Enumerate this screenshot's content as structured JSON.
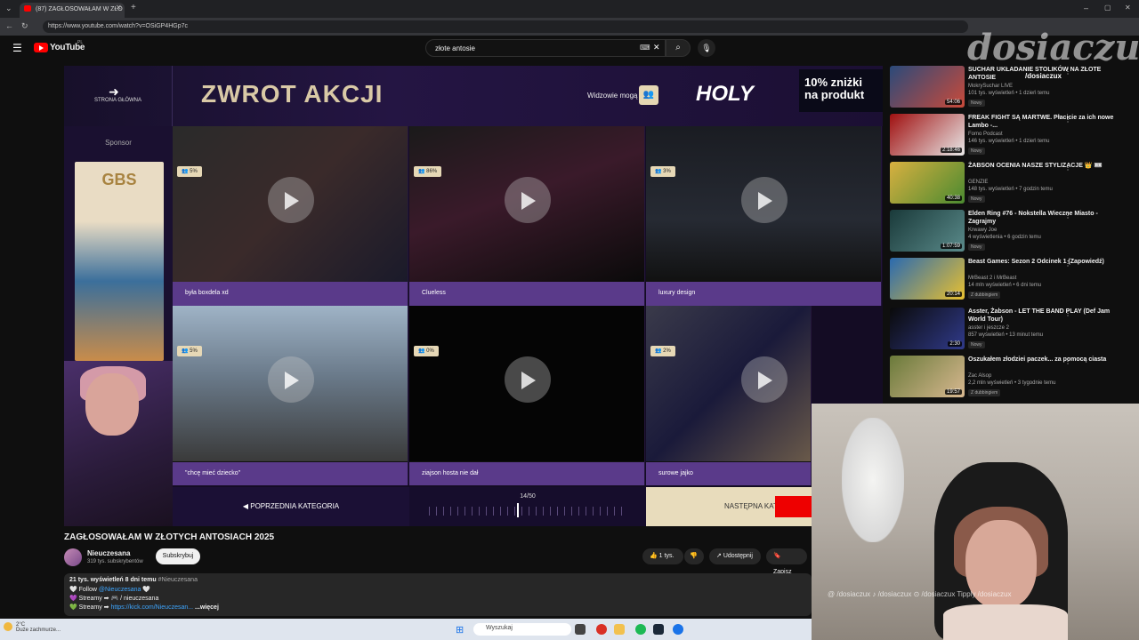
{
  "browser": {
    "tab_title": "(87) ZAGŁOSOWAŁAM W ZŁO",
    "url": "https://www.youtube.com/watch?v=OSiGP4HGp7c"
  },
  "youtube": {
    "logo_text": "YouTube",
    "country": "PL",
    "search_value": "złote antosie"
  },
  "video_overlay": {
    "home_label": "STRONA GŁÓWNA",
    "header_title": "ZWROT AKCJI",
    "viewers_label": "Widzowie mogą",
    "brand": "HOLY",
    "promo": "10% zniżki na produkt",
    "sponsor_label": "Sponsor",
    "ad_brand": "GBS",
    "tiles": [
      {
        "percent": "5%",
        "caption": "była boxdela xd"
      },
      {
        "percent": "86%",
        "caption": "Clueless"
      },
      {
        "percent": "3%",
        "caption": "luxury design"
      },
      {
        "percent": "5%",
        "caption": "\"chcę mieć dziecko\""
      },
      {
        "percent": "0%",
        "caption": "ziajson hosta nie dał"
      },
      {
        "percent": "2%",
        "caption": "surowe jajko"
      }
    ],
    "prev_category": "POPRZEDNIA KATEGORIA",
    "page": "14/50",
    "next_category": "NASTĘPNA KATEG"
  },
  "video_info": {
    "title": "ZAGŁOSOWAŁAM W ZŁOTYCH ANTOSIACH 2025",
    "channel": "Nieuczesana",
    "subscribers": "319 tys. subskrybentów",
    "subscribe_label": "Subskrybuj",
    "likes": "1 tys.",
    "share_label": "Udostępnij",
    "save_label": "Zapisz",
    "views_line": "21 tys. wyświetleń  8 dni temu",
    "hashtag": "#Nieuczesana",
    "desc_line1_prefix": "🤍 Follow",
    "desc_line1_link": "@Nieuczesana",
    "desc_line2": "💜 Streamy ➡ 🎮 / nieuczesana",
    "desc_line3_prefix": "💚 Streamy ➡",
    "desc_line3_link": "https://kick.com/Nieuczesan...",
    "more": "...więcej"
  },
  "recommendations": [
    {
      "title": "SUCHAR UKŁADANIE STOLIKÓW NA ZŁOTE ANTOSIE",
      "channel": "MokrySuchar LIVE",
      "meta": "101 tys. wyświetleń • 1 dzień temu",
      "badge": "Nowy",
      "duration": "54:06",
      "thumb_colors": [
        "#2b4a7a",
        "#c94a3a"
      ]
    },
    {
      "title": "FREAK FIGHT SĄ MARTWE. Płacicie za ich nowe Lambo -...",
      "channel": "Fomo Podcast",
      "meta": "146 tys. wyświetleń • 1 dzień temu",
      "badge": "Nowy",
      "duration": "2:18:46",
      "thumb_colors": [
        "#a01010",
        "#e8e8e8"
      ]
    },
    {
      "title": "ŻABSON OCENIA NASZE STYLIZACJE 👑 🎟",
      "channel": "GENZIE",
      "meta": "148 tys. wyświetleń • 7 godzin temu",
      "badge": "Nowy",
      "duration": "40:38",
      "thumb_colors": [
        "#d8b040",
        "#4a8a30"
      ]
    },
    {
      "title": "Elden Ring #76 - Nokstella Wieczne Miasto - Zagrajmy",
      "channel": "Krwawy Joe",
      "meta": "4 wyświetlenia • 6 godzin temu",
      "badge": "Nowy",
      "duration": "1:07:59",
      "thumb_colors": [
        "#1a3a3a",
        "#5a8a8a"
      ]
    },
    {
      "title": "Beast Games: Sezon 2 Odcinek 1 (Zapowiedź)",
      "channel": "MrBeast 2 i MrBeast",
      "meta": "14 mln wyświetleń • 6 dni temu",
      "badge": "Z dubbingiem",
      "duration": "20:14",
      "thumb_colors": [
        "#2a6ab0",
        "#e8c030"
      ]
    },
    {
      "title": "Asster, Żabson - LET THE BAND PLAY (Def Jam World Tour)",
      "channel": "asster i jeszcze 2",
      "meta": "857 wyświetleń • 13 minut temu",
      "badge": "Nowy",
      "duration": "2:30",
      "thumb_colors": [
        "#0a0a0a",
        "#303a8a"
      ]
    },
    {
      "title": "Oszukałem złodziei paczek... za pomocą ciasta",
      "channel": "Zac Alsop",
      "meta": "2,2 mln wyświetleń • 3 tygodnie temu",
      "badge": "Z dubbingiem",
      "duration": "19:57",
      "thumb_colors": [
        "#6a7a3a",
        "#d8b890"
      ]
    }
  ],
  "streamer": {
    "watermark": "dosiaczux",
    "handle": "/dosiaczux",
    "socials": "@ /dosiaczux    ♪ /dosiaczux    ⊙ /dosiaczux    Tipply /dosiaczux"
  },
  "taskbar": {
    "weather_temp": "2°C",
    "weather_desc": "Duże zachmurze...",
    "search_placeholder": "Wyszukaj"
  }
}
